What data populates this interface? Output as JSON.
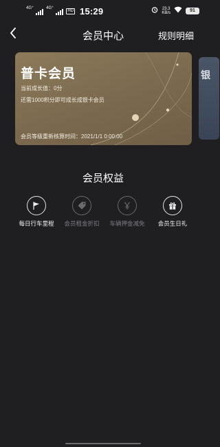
{
  "status_bar": {
    "network_left": "4G⁺",
    "network_right": "4G⁺",
    "hd_badge": "HD",
    "time": "15:29",
    "speed_value": "23.3",
    "speed_unit": "KB/s",
    "battery": "91"
  },
  "header": {
    "title": "会员中心",
    "rules_label": "规则明细"
  },
  "card": {
    "level": "普卡会员",
    "growth": "当前成长值：0分",
    "upgrade_hint": "还需1000积分即可成长成银卡会员",
    "reset_time": "会员等级重新核算时间：2021/1/1 0:00:00"
  },
  "peek_card": {
    "char": "银"
  },
  "benefits": {
    "title": "会员权益",
    "items": [
      {
        "label": "每日行车里程",
        "icon": "flag-icon",
        "active": true
      },
      {
        "label": "会员租金折扣",
        "icon": "tag-icon",
        "active": false
      },
      {
        "label": "车辆押金减免",
        "icon": "yen-icon",
        "active": false
      },
      {
        "label": "会员生日礼",
        "icon": "gift-icon",
        "active": true
      }
    ]
  },
  "colors": {
    "background": "#1f1f21",
    "card_gold": "#8d7a5b",
    "inactive_text": "#7c7c80"
  }
}
